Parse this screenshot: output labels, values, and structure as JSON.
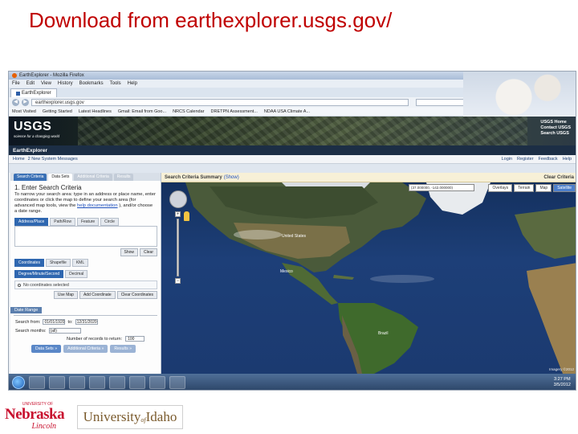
{
  "slide": {
    "title": "Download from earthexplorer.usgs.gov/"
  },
  "browser": {
    "window_title": "EarthExplorer - Mozilla Firefox",
    "menu": [
      "File",
      "Edit",
      "View",
      "History",
      "Bookmarks",
      "Tools",
      "Help"
    ],
    "tab_label": "EarthExplorer",
    "url": "earthexplorer.usgs.gov",
    "bookmarks": [
      "Most Visited",
      "Getting Started",
      "Latest Headlines",
      "Gmail: Email from Goo...",
      "NRCS Calendar",
      "DRETPN Assessment...",
      "NDAA USA Climate A..."
    ]
  },
  "usgs": {
    "wordmark": "USGS",
    "tagline": "science for a changing world",
    "links": [
      "USGS Home",
      "Contact USGS",
      "Search USGS"
    ],
    "app_name": "EarthExplorer",
    "nav_left": [
      "Home",
      "2 New System Messages"
    ],
    "nav_right": [
      "Login",
      "Register",
      "Feedback",
      "Help"
    ]
  },
  "left_panel": {
    "tabs": [
      "Search Criteria",
      "Data Sets",
      "Additional Criteria",
      "Results"
    ],
    "heading": "1. Enter Search Criteria",
    "instructions_1": "To narrow your search area: type in an address or place name, enter coordinates or click the map to define your search area (for advanced map tools, view the",
    "instructions_link": "help documentation",
    "instructions_2": "), and/or choose a date range.",
    "address_tabs": [
      "Address/Place",
      "Path/Row",
      "Feature",
      "Circle"
    ],
    "show_button": "Show",
    "clear_button": "Clear",
    "coord_tabs": [
      "Coordinates",
      "Shapefile",
      "KML"
    ],
    "format_tabs": [
      "Degree/Minute/Second",
      "Decimal"
    ],
    "no_coords": "No coordinates selected",
    "coord_buttons": [
      "Use Map",
      "Add Coordinate",
      "Clear Coordinates"
    ],
    "date_range_label": "Date Range",
    "search_from_label": "Search from:",
    "date_from": "01/01/1920",
    "to_label": "to:",
    "date_to": "12/31/2020",
    "search_months_label": "Search months:",
    "search_months_value": "(all)",
    "records_label": "Number of records to return:",
    "records_value": "100",
    "bottom_buttons": [
      "Data Sets »",
      "Additional Criteria »",
      "Results »"
    ]
  },
  "map_panel": {
    "summary_label": "Search Criteria Summary",
    "summary_show": "(Show)",
    "clear_criteria": "Clear Criteria",
    "coord_readout": "(37.000000, -142.000000)",
    "map_types": [
      "Overlays",
      "Terrain",
      "Map",
      "Satellite"
    ],
    "active_map_type": "Satellite",
    "place_labels": [
      "United States",
      "Mexico",
      "Brazil"
    ],
    "credit": "Imagery ©2012"
  },
  "taskbar": {
    "time": "3:27 PM",
    "date": "3/5/2012"
  },
  "logos": {
    "nebraska_top": "UNIVERSITY OF",
    "nebraska_name": "Nebraska",
    "nebraska_city": "Lincoln",
    "idaho_university": "University",
    "idaho_of": "of",
    "idaho_name": "Idaho"
  },
  "colors": {
    "title_red": "#c00000",
    "usgs_dark": "#1c2e45",
    "map_ocean": "#1b3a70",
    "nebraska_red": "#c8102e",
    "idaho_gold": "#7a5a2c"
  }
}
